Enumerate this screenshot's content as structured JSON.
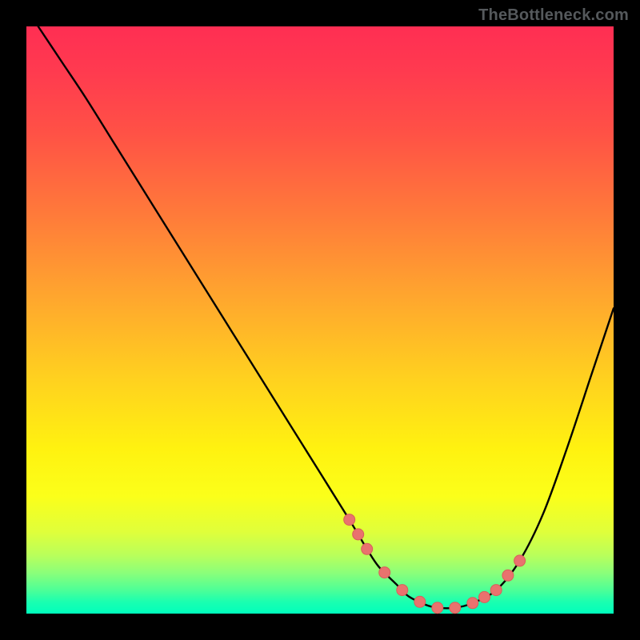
{
  "watermark": "TheBottleneck.com",
  "chart_data": {
    "type": "line",
    "title": "",
    "xlabel": "",
    "ylabel": "",
    "xlim": [
      0,
      100
    ],
    "ylim": [
      0,
      100
    ],
    "grid": false,
    "series": [
      {
        "name": "curve",
        "x": [
          2,
          6,
          10,
          15,
          20,
          25,
          30,
          35,
          40,
          45,
          50,
          55,
          58,
          60,
          63,
          65,
          68,
          70,
          73,
          76,
          80,
          84,
          88,
          92,
          96,
          100
        ],
        "values": [
          100,
          94,
          88,
          80,
          72,
          64,
          56,
          48,
          40,
          32,
          24,
          16,
          11,
          8,
          5,
          3,
          1.5,
          1,
          1,
          1.8,
          4,
          9,
          17,
          28,
          40,
          52
        ]
      }
    ],
    "markers": {
      "name": "highlight-points",
      "x": [
        55,
        56.5,
        58,
        61,
        64,
        67,
        70,
        73,
        76,
        78,
        80,
        82,
        84
      ],
      "values": [
        16,
        13.5,
        11,
        7,
        4,
        2,
        1,
        1,
        1.8,
        2.8,
        4,
        6.5,
        9
      ]
    },
    "background_gradient": {
      "top": "#ff2e53",
      "mid": "#fff210",
      "bottom": "#00ffbc"
    }
  }
}
